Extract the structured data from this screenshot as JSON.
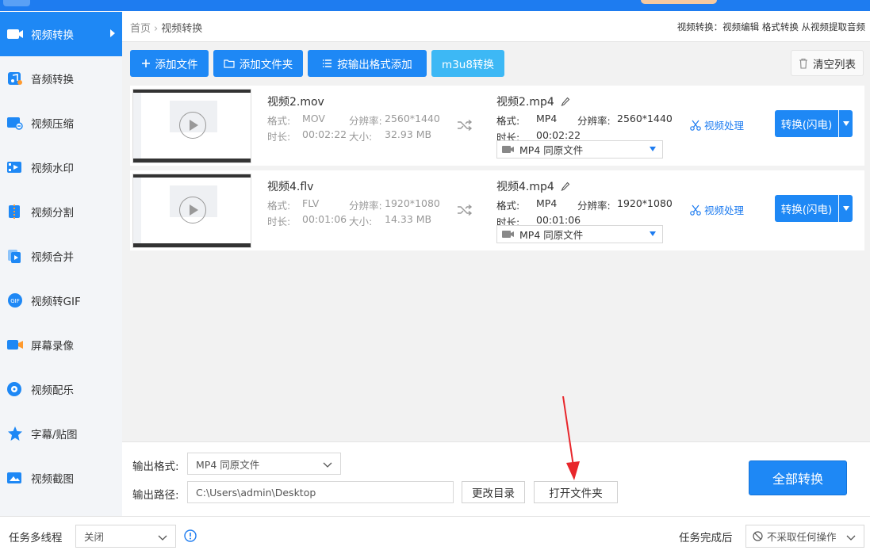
{
  "sidebar": {
    "items": [
      {
        "label": "视频转换",
        "icon": "video-convert-icon",
        "active": true
      },
      {
        "label": "音频转换",
        "icon": "audio-convert-icon"
      },
      {
        "label": "视频压缩",
        "icon": "video-compress-icon"
      },
      {
        "label": "视频水印",
        "icon": "video-watermark-icon"
      },
      {
        "label": "视频分割",
        "icon": "video-split-icon"
      },
      {
        "label": "视频合并",
        "icon": "video-merge-icon"
      },
      {
        "label": "视频转GIF",
        "icon": "video-gif-icon"
      },
      {
        "label": "屏幕录像",
        "icon": "screen-record-icon"
      },
      {
        "label": "视频配乐",
        "icon": "video-music-icon"
      },
      {
        "label": "字幕/贴图",
        "icon": "subtitle-sticker-icon"
      },
      {
        "label": "视频截图",
        "icon": "video-screenshot-icon"
      }
    ]
  },
  "breadcrumb": {
    "home": "首页",
    "current": "视频转换",
    "separator": "›"
  },
  "header_hint": "视频转换：视频编辑 格式转换 从视频提取音频",
  "toolbar": {
    "add_file": "添加文件",
    "add_folder": "添加文件夹",
    "add_by_format": "按输出格式添加",
    "m3u8": "m3u8转换",
    "clear_list": "清空列表"
  },
  "labels": {
    "format": "格式:",
    "resolution": "分辨率:",
    "duration": "时长:",
    "size": "大小:",
    "video_process": "视频处理",
    "convert_flash": "转换(闪电)"
  },
  "files": [
    {
      "name": "视频2.mov",
      "format": "MOV",
      "resolution": "2560*1440",
      "duration": "00:02:22",
      "size": "32.93 MB",
      "output_name": "视频2.mp4",
      "output_format": "MP4",
      "output_resolution": "2560*1440",
      "output_duration": "00:02:22",
      "output_preset": "MP4  同原文件"
    },
    {
      "name": "视频4.flv",
      "format": "FLV",
      "resolution": "1920*1080",
      "duration": "00:01:06",
      "size": "14.33 MB",
      "output_name": "视频4.mp4",
      "output_format": "MP4",
      "output_resolution": "1920*1080",
      "output_duration": "00:01:06",
      "output_preset": "MP4  同原文件"
    }
  ],
  "bottom": {
    "output_format_label": "输出格式:",
    "output_format_value": "MP4  同原文件",
    "output_path_label": "输出路径:",
    "output_path_value": "C:\\Users\\admin\\Desktop",
    "change_dir": "更改目录",
    "open_folder": "打开文件夹",
    "convert_all": "全部转换"
  },
  "statusbar": {
    "multithread_label": "任务多线程",
    "multithread_value": "关闭",
    "after_task_label": "任务完成后",
    "after_task_value": "不采取任何操作"
  },
  "colors": {
    "primary": "#1e88f5",
    "accent_light": "#3db8f5",
    "annotation_red": "#e8262b"
  }
}
